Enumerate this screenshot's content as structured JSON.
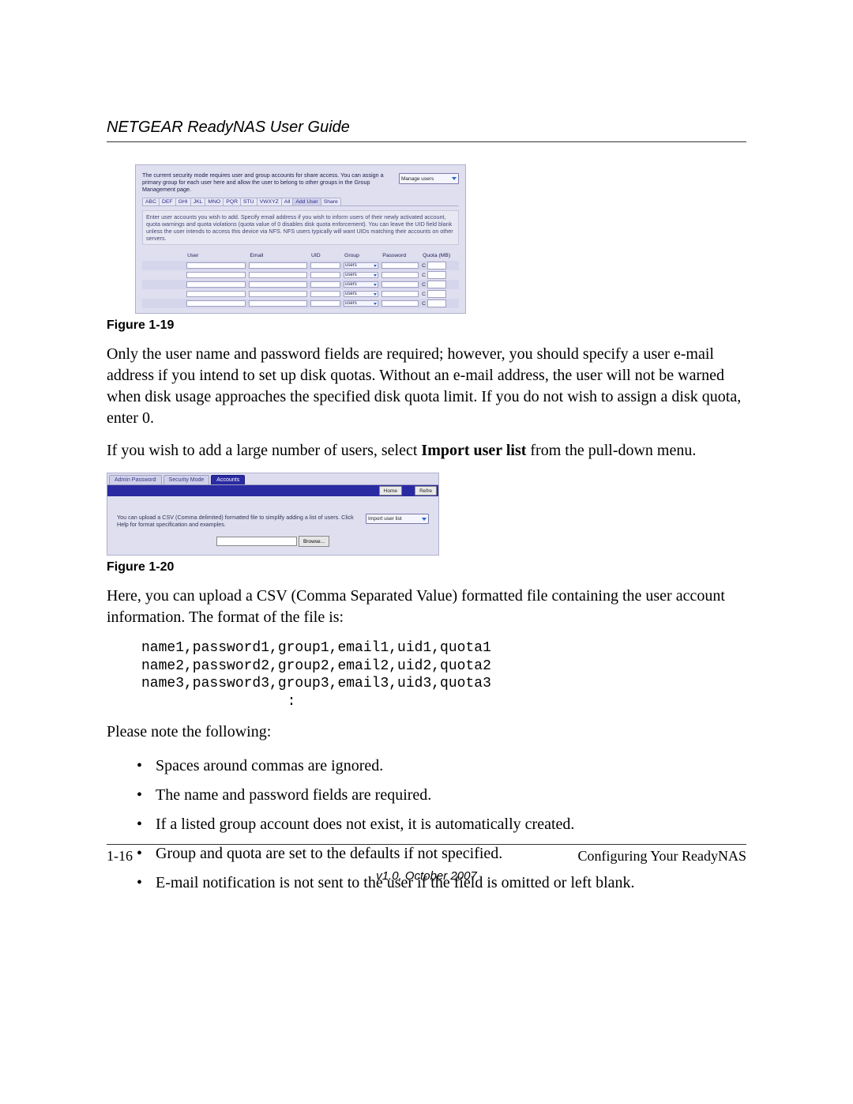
{
  "header": {
    "title": "NETGEAR ReadyNAS User Guide"
  },
  "fig19": {
    "intro": "The current security mode requires user and group accounts for share access. You can assign a primary group for each user here and allow the user to belong to other groups in the Group Management page.",
    "select_label": "Manage users",
    "tabs": [
      "ABC",
      "DEF",
      "GHI",
      "JKL",
      "MNO",
      "PQR",
      "STU",
      "VWXYZ",
      "All",
      "Add User",
      "Share"
    ],
    "active_tab_index": 9,
    "help": "Enter user accounts you wish to add. Specify email address if you wish to inform users of their newly activated account, quota warnings and quota violations (quota value of 0 disables disk quota enforcement). You can leave the UID field blank unless the user intends to access this device via NFS. NFS users typically will want UIDs matching their accounts on other servers.",
    "cols": {
      "user": "User",
      "email": "Email",
      "uid": "UID",
      "group": "Group",
      "password": "Password",
      "quota": "Quota (MB)"
    },
    "group_option": "users",
    "quota_prefix": "C",
    "row_count": 5
  },
  "caption19": "Figure 1-19",
  "para1": "Only the user name and password fields are required; however, you should specify a user e-mail address if you intend to set up disk quotas. Without an e-mail address, the user will not be warned when disk usage approaches the specified disk quota limit. If you do not wish to assign a disk quota, enter 0.",
  "para2_pre": "If you wish to add a large number of users, select ",
  "para2_bold": "Import user list",
  "para2_post": " from the pull-down menu.",
  "fig20": {
    "top_tabs": [
      "Admin Password",
      "Security Mode",
      "Accounts"
    ],
    "active_top_index": 2,
    "home_btn": "Home",
    "refresh_btn": "Refre",
    "msg": "You can upload a CSV (Comma delimited) formatted file to simplify adding a list of users. Click Help for format specification and examples.",
    "import_select": "Import user list",
    "browse_btn": "Browse..."
  },
  "caption20": "Figure 1-20",
  "para3": "Here, you can upload a CSV (Comma Separated Value) formatted file containing the user account information. The format of the file is:",
  "csv_lines": [
    "name1,password1,group1,email1,uid1,quota1",
    "name2,password2,group2,email2,uid2,quota2",
    "name3,password3,group3,email3,uid3,quota3"
  ],
  "csv_etc": ":",
  "para4": "Please note the following:",
  "bullets": [
    "Spaces around commas are ignored.",
    "The name and password fields are required.",
    "If a listed group account does not exist, it is automatically created.",
    "Group and quota are set to the defaults if not specified.",
    "E-mail notification is not sent to the user if the field is omitted or left blank."
  ],
  "footer": {
    "page": "1-16",
    "section": "Configuring Your ReadyNAS",
    "version": "v1.0, October 2007"
  }
}
